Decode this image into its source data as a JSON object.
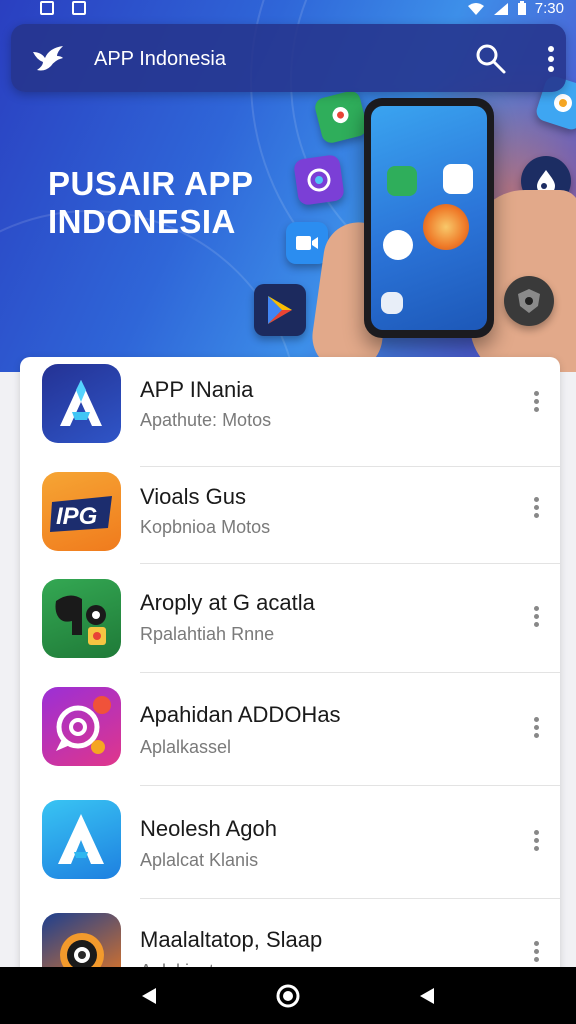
{
  "status_bar": {
    "time": "7:30",
    "icons": [
      "notification-icon",
      "notification-icon",
      "wifi-icon",
      "signal-icon",
      "battery-icon"
    ]
  },
  "app_bar": {
    "title": "APP Indonesia",
    "logo_icon": "bird-logo-icon",
    "search_icon": "search-icon",
    "menu_icon": "more-vert-icon"
  },
  "hero": {
    "title_line1": "PUSAIR APP",
    "title_line2": "INDONESIA"
  },
  "apps": [
    {
      "name": "APP INania",
      "subtitle": "Apathute: Motos",
      "icon": "letter-a-app-icon",
      "colors": [
        "#2b3a9e",
        "#3b8ae6"
      ]
    },
    {
      "name": "Vioals Gus",
      "subtitle": "Kopbnioa Motos",
      "icon": "ipg-app-icon",
      "colors": [
        "#f39a2c",
        "#f2781c"
      ]
    },
    {
      "name": "Aroply at G acatla",
      "subtitle": "Rpalahtiah Rnne",
      "icon": "elephant-app-icon",
      "colors": [
        "#2e9a47",
        "#1f7a38"
      ]
    },
    {
      "name": "Apahidan ADDOHas",
      "subtitle": "Aplalkassel",
      "icon": "chat-bubble-app-icon",
      "colors": [
        "#b02fd1",
        "#e0368b"
      ]
    },
    {
      "name": "Neolesh Agoh",
      "subtitle": "Aplalcat Klanis",
      "icon": "letter-a-app-icon",
      "colors": [
        "#2fb7f0",
        "#1e7fe0"
      ]
    },
    {
      "name": "Maalaltatop, Slaap",
      "subtitle": "Aplakiaat",
      "icon": "camera-lens-app-icon",
      "colors": [
        "#1d3f8f",
        "#f07a1e"
      ]
    }
  ],
  "nav_bar": {
    "back_icon": "back-triangle-icon",
    "home_icon": "home-circle-icon",
    "recent_icon": "recent-triangle-icon"
  },
  "colors": {
    "accent": "#2f66d8",
    "app_bar": "#26348c"
  }
}
